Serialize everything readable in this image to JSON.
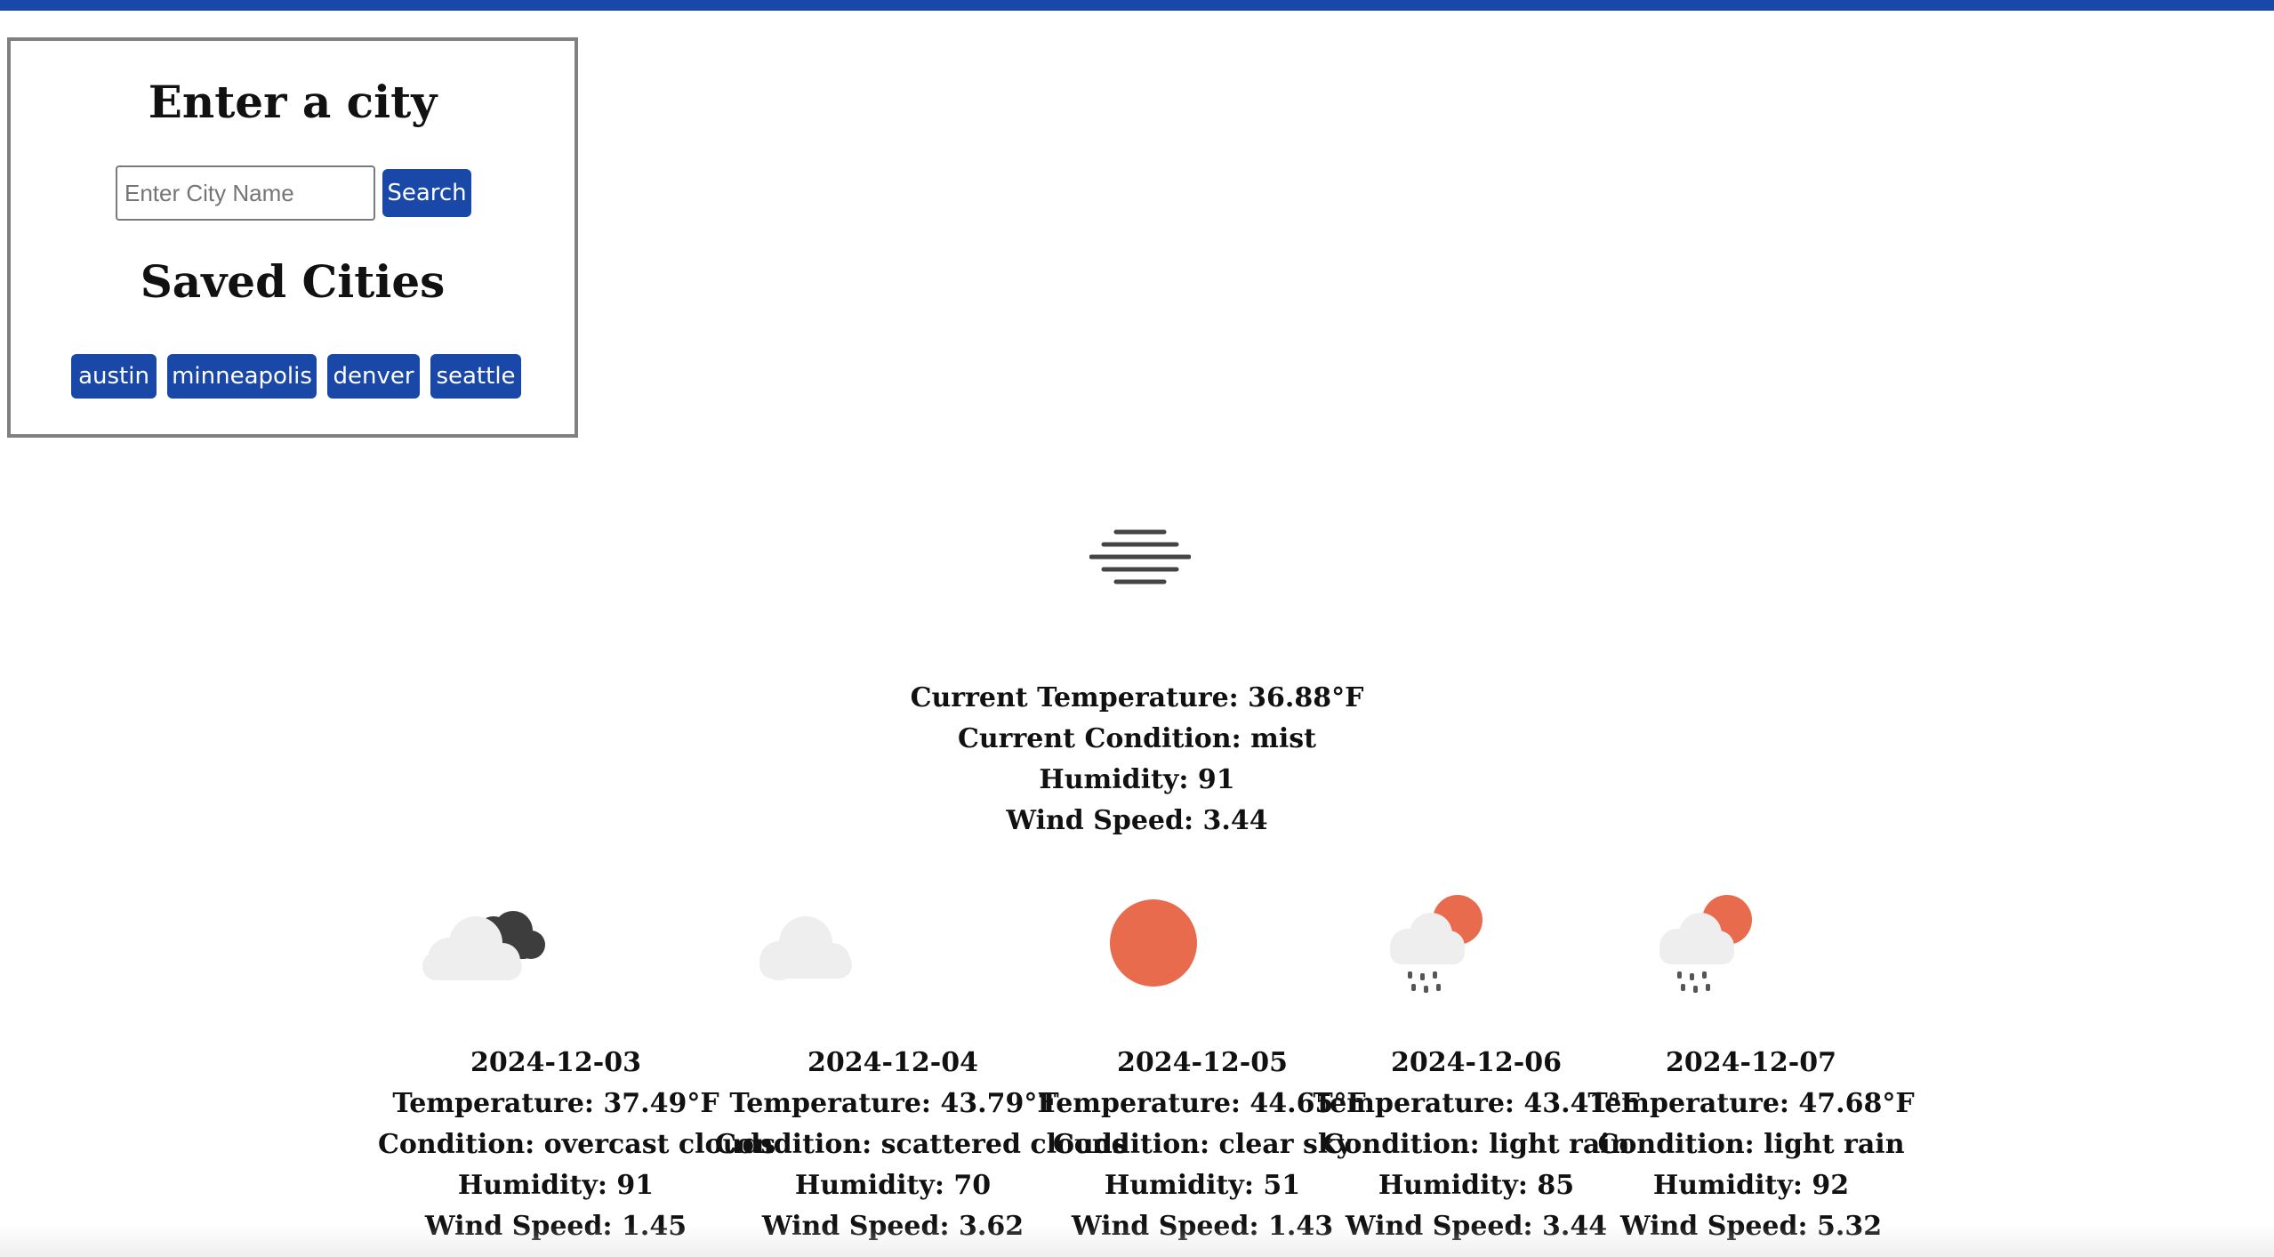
{
  "search": {
    "heading": "Enter a city",
    "input_placeholder": "Enter City Name",
    "input_value": "",
    "button_label": "Search",
    "saved_heading": "Saved Cities",
    "saved_cities": [
      "austin",
      "minneapolis",
      "denver",
      "seattle"
    ]
  },
  "colors": {
    "accent": "#1a48a8",
    "panel_border": "#808080",
    "sun": "#e86b4e",
    "cloud_light": "#eeeeee",
    "cloud_dark": "#3d3d3d",
    "mist": "#444444"
  },
  "current": {
    "icon": "mist-icon",
    "temperature": "Current Temperature: 36.88°F",
    "condition": "Current Condition: mist",
    "humidity": "Humidity: 91",
    "wind": "Wind Speed: 3.44"
  },
  "forecast": [
    {
      "icon": "overcast-clouds-icon",
      "date": "2024-12-03",
      "temperature": "Temperature: 37.49°F",
      "condition": "Condition: overcast clouds",
      "humidity": "Humidity: 91",
      "wind": "Wind Speed: 1.45"
    },
    {
      "icon": "scattered-clouds-icon",
      "date": "2024-12-04",
      "temperature": "Temperature: 43.79°F",
      "condition": "Condition: scattered clouds",
      "humidity": "Humidity: 70",
      "wind": "Wind Speed: 3.62"
    },
    {
      "icon": "clear-sky-icon",
      "date": "2024-12-05",
      "temperature": "Temperature: 44.65°F",
      "condition": "Condition: clear sky",
      "humidity": "Humidity: 51",
      "wind": "Wind Speed: 1.43"
    },
    {
      "icon": "light-rain-icon",
      "date": "2024-12-06",
      "temperature": "Temperature: 43.41°F",
      "condition": "Condition: light rain",
      "humidity": "Humidity: 85",
      "wind": "Wind Speed: 3.44"
    },
    {
      "icon": "light-rain-icon",
      "date": "2024-12-07",
      "temperature": "Temperature: 47.68°F",
      "condition": "Condition: light rain",
      "humidity": "Humidity: 92",
      "wind": "Wind Speed: 5.32"
    }
  ]
}
